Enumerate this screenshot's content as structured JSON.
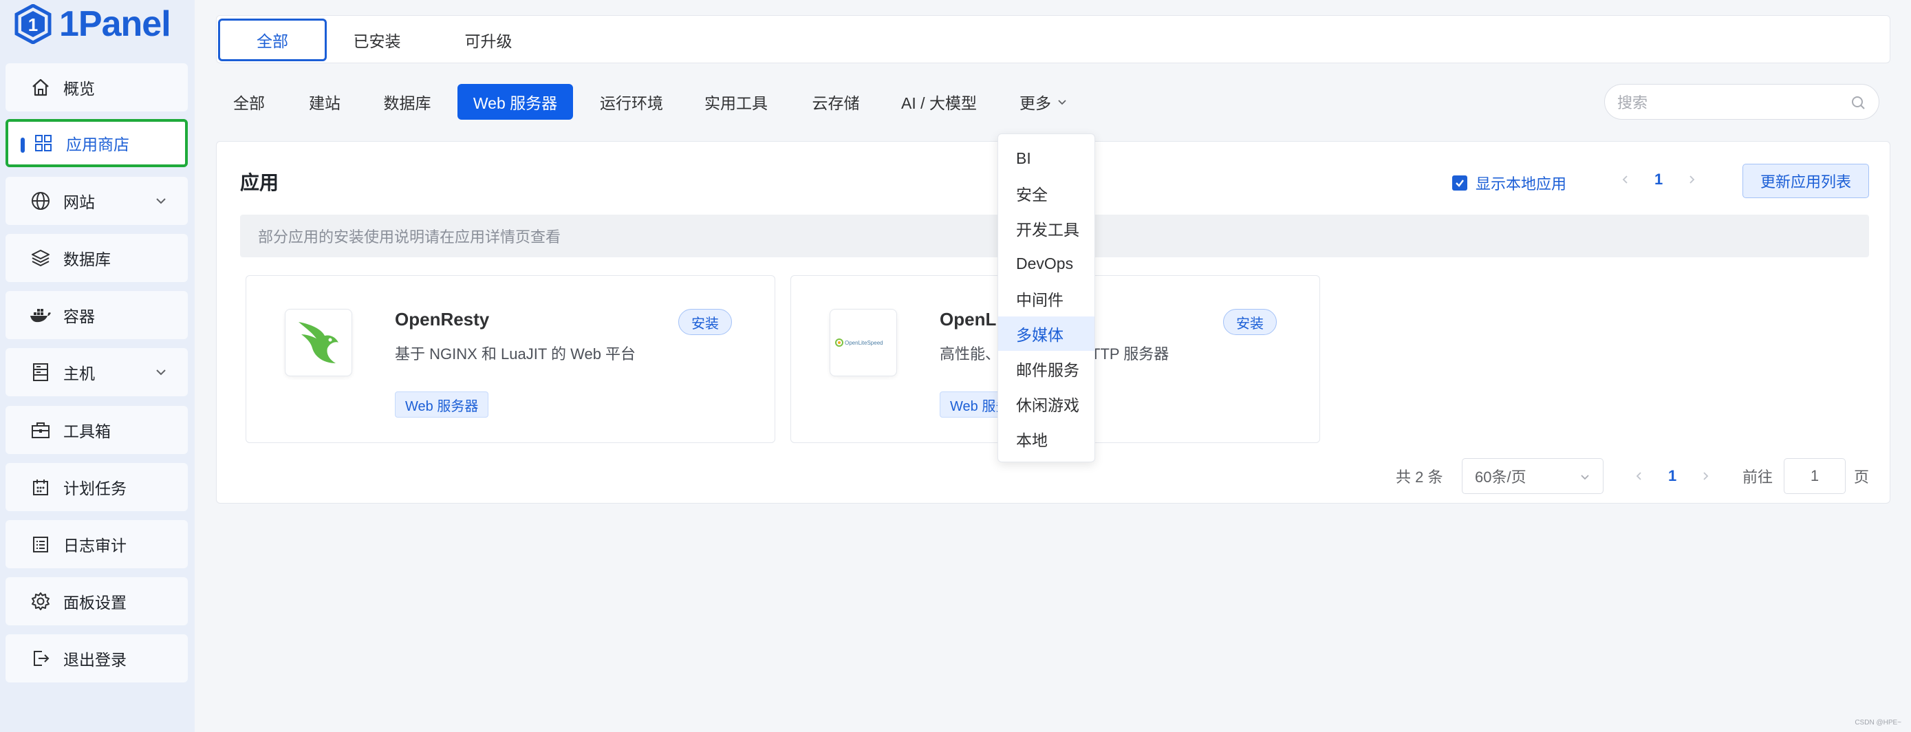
{
  "brand": {
    "name": "1Panel"
  },
  "sidebar": {
    "items": [
      {
        "label": "概览",
        "icon": "home-icon"
      },
      {
        "label": "应用商店",
        "icon": "grid-icon",
        "active": true
      },
      {
        "label": "网站",
        "icon": "globe-icon",
        "expandable": true
      },
      {
        "label": "数据库",
        "icon": "layers-icon"
      },
      {
        "label": "容器",
        "icon": "docker-icon"
      },
      {
        "label": "主机",
        "icon": "server-icon",
        "expandable": true
      },
      {
        "label": "工具箱",
        "icon": "toolbox-icon"
      },
      {
        "label": "计划任务",
        "icon": "calendar-icon"
      },
      {
        "label": "日志审计",
        "icon": "log-icon"
      },
      {
        "label": "面板设置",
        "icon": "gear-icon"
      },
      {
        "label": "退出登录",
        "icon": "logout-icon"
      }
    ]
  },
  "top_tabs": [
    {
      "label": "全部",
      "selected": true
    },
    {
      "label": "已安装"
    },
    {
      "label": "可升级"
    }
  ],
  "categories": [
    {
      "label": "全部"
    },
    {
      "label": "建站"
    },
    {
      "label": "数据库"
    },
    {
      "label": "Web 服务器",
      "selected": true
    },
    {
      "label": "运行环境"
    },
    {
      "label": "实用工具"
    },
    {
      "label": "云存储"
    },
    {
      "label": "AI / 大模型"
    },
    {
      "label": "更多"
    }
  ],
  "search": {
    "placeholder": "搜索"
  },
  "main": {
    "title": "应用",
    "show_local_label": "显示本地应用",
    "show_local_checked": true,
    "top_page": "1",
    "refresh_label": "更新应用列表",
    "notice": "部分应用的安装使用说明请在应用详情页查看"
  },
  "apps": [
    {
      "name": "OpenResty",
      "desc": "基于 NGINX 和 LuaJIT 的 Web 平台",
      "install_label": "安装",
      "tag": "Web 服务器"
    },
    {
      "name": "OpenLi",
      "desc": "高性能、",
      "desc_tail": "的 HTTP 服务器",
      "install_label": "安装",
      "tag": "Web 服务",
      "logo_text": "OpenLiteSpeed"
    }
  ],
  "dropdown": {
    "items": [
      "BI",
      "安全",
      "开发工具",
      "DevOps",
      "中间件",
      "多媒体",
      "邮件服务",
      "休闲游戏",
      "本地"
    ],
    "highlighted": "多媒体"
  },
  "pagination": {
    "total": "共 2 条",
    "page_size": "60条/页",
    "current": "1",
    "goto_label": "前往",
    "goto_value": "1",
    "page_suffix": "页"
  },
  "footer": {
    "watermark": "CSDN @HPE~"
  },
  "colors": {
    "accent": "#1c5fd6",
    "highlight_border": "#1faa3b",
    "category_selected": "#0f5ee8"
  }
}
